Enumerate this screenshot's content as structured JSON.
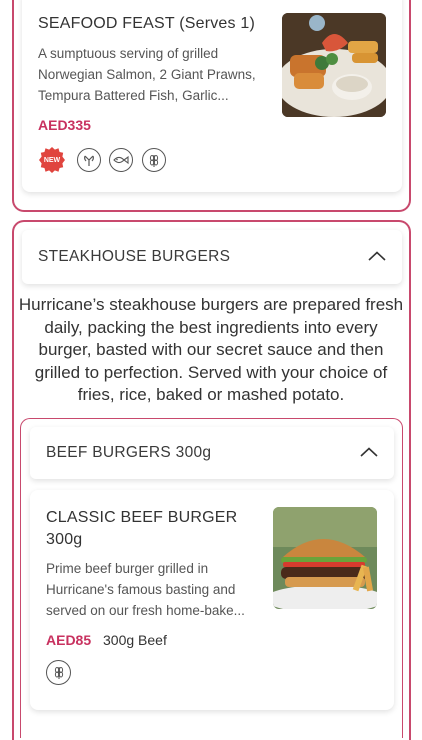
{
  "seafood_item": {
    "title": "SEAFOOD FEAST (Serves 1)",
    "description_lines": [
      "A sumptuous serving of grilled",
      "Norwegian Salmon, 2 Giant Prawns,",
      "Tempura Battered Fish, Garlic..."
    ],
    "price": "AED335",
    "badge": "NEW",
    "tags": [
      "new-badge",
      "shellfish-icon",
      "fish-icon",
      "wheat-icon"
    ]
  },
  "section": {
    "title": "STEAKHOUSE BURGERS",
    "description": "Hurricane’s steakhouse burgers are prepared fresh daily, packing the best ingredients into every burger, basted with our secret sauce and then grilled to perfection. Served with your choice of fries, rice, baked or mashed potato."
  },
  "subsection": {
    "title": "BEEF BURGERS 300g"
  },
  "burger_item": {
    "title_lines": [
      "CLASSIC BEEF BURGER",
      "300g"
    ],
    "description_lines": [
      "Prime beef burger grilled in",
      "Hurricane's famous basting and",
      "served on our fresh home-bake..."
    ],
    "price": "AED85",
    "weight": "300g Beef",
    "tags": [
      "wheat-icon"
    ]
  },
  "colors": {
    "accent": "#c8496d",
    "price": "#c8315f",
    "badge": "#e0443e"
  }
}
